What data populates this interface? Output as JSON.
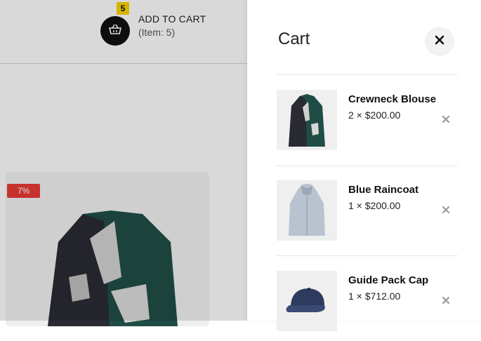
{
  "header": {
    "cart_badge": "5",
    "cart_title": "ADD TO CART",
    "cart_count": "(Item: 5)"
  },
  "product": {
    "discount": "7%"
  },
  "cart": {
    "title": "Cart",
    "items": [
      {
        "name": "Crewneck Blouse",
        "meta": "2 × $200.00"
      },
      {
        "name": "Blue Raincoat",
        "meta": "1 × $200.00"
      },
      {
        "name": "Guide Pack Cap",
        "meta": "1 × $712.00"
      }
    ]
  },
  "colors": {
    "badge": "#f5d000",
    "discount": "#e53935",
    "accent_dark": "#111111"
  },
  "icons": {
    "cart_button": "basket-icon",
    "close": "close-icon",
    "remove": "remove-icon"
  }
}
